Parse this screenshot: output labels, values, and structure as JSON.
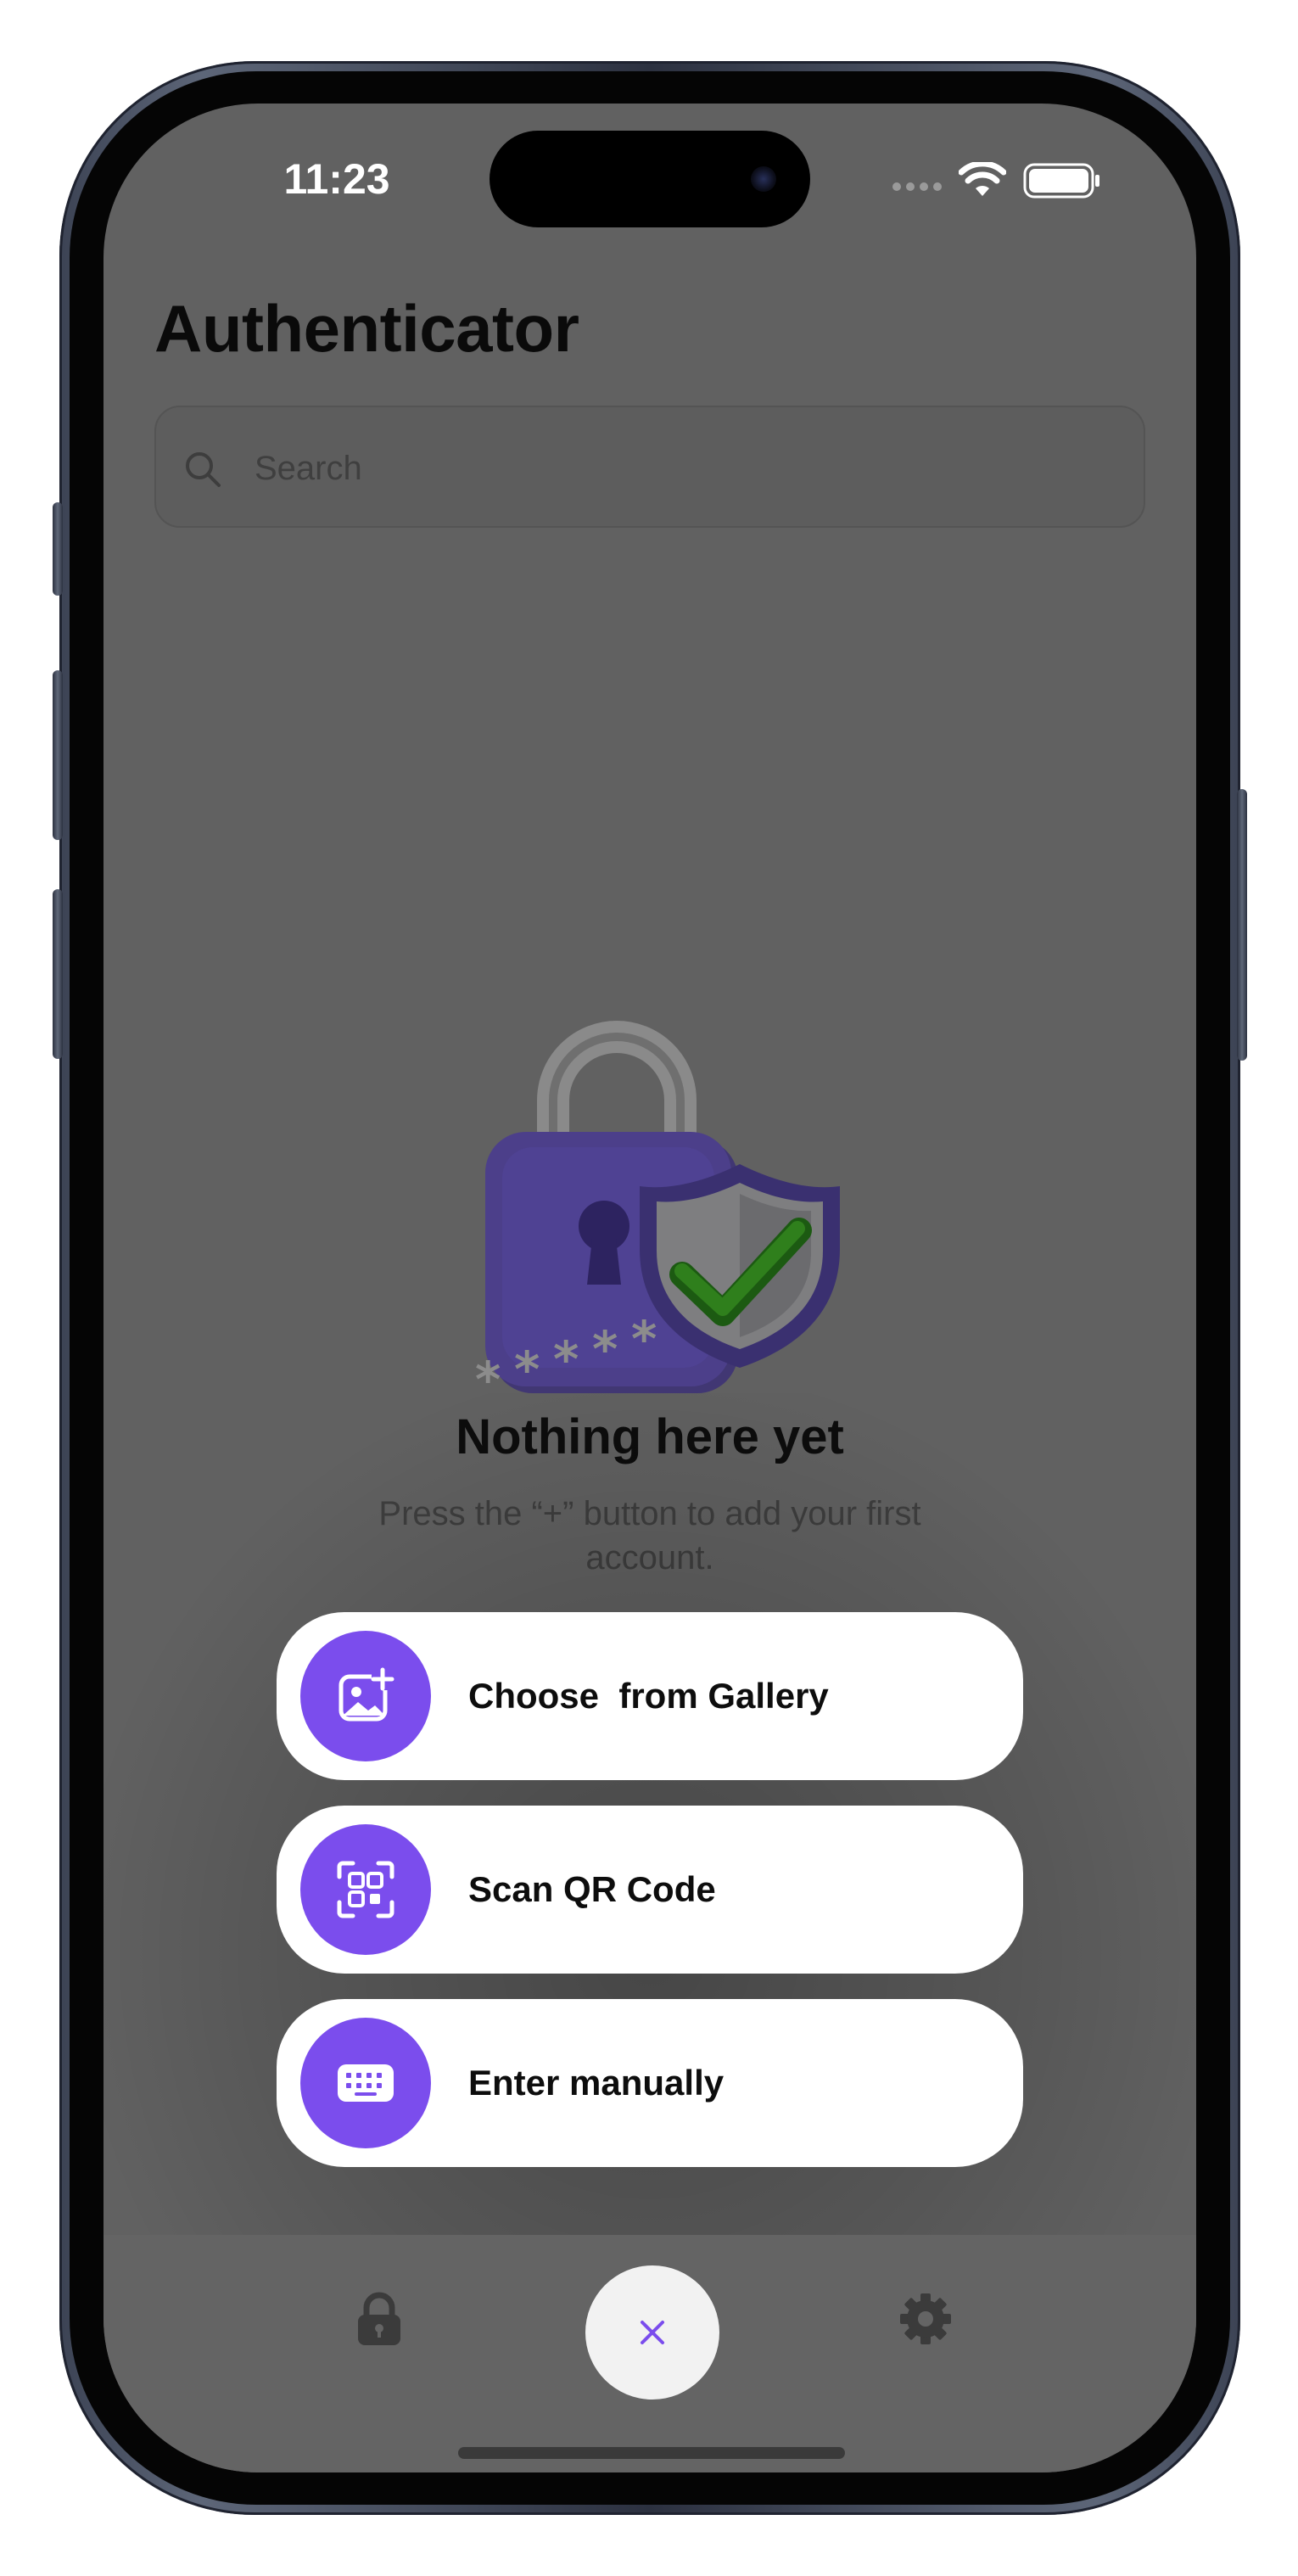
{
  "status_bar": {
    "time": "11:23"
  },
  "header": {
    "title": "Authenticator"
  },
  "search": {
    "placeholder": "Search",
    "value": ""
  },
  "empty_state": {
    "title": "Nothing here yet",
    "subtitle": "Press the “+” button to add your first account."
  },
  "add_menu": {
    "options": [
      {
        "label": "Choose  from Gallery",
        "icon": "gallery-add-icon"
      },
      {
        "label": "Scan QR Code",
        "icon": "qr-scan-icon"
      },
      {
        "label": "Enter manually",
        "icon": "keyboard-icon"
      }
    ]
  },
  "tab_bar": {
    "left_icon": "lock-icon",
    "center_icon": "close-icon",
    "right_icon": "gear-icon"
  },
  "colors": {
    "accent": "#7b4ded",
    "overlay": "#616161"
  }
}
